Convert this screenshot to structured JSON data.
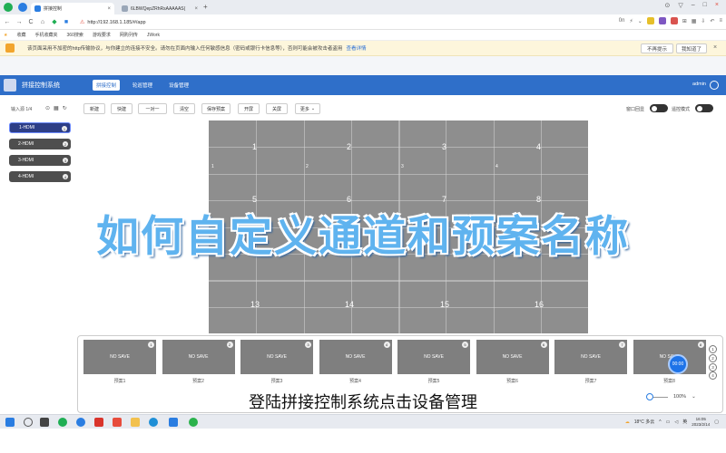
{
  "browser": {
    "tabs": [
      {
        "label": "拼接控制",
        "active": true
      },
      {
        "label": "6LBWQepZRhRsAAAAAS(",
        "active": false
      }
    ],
    "url": "http://192.168.1.185/#/app",
    "bookmarks": [
      "收藏",
      "手机收藏夹",
      "360搜索",
      "游戏要求",
      "网购列传",
      "JWork"
    ]
  },
  "warning": {
    "text": "该页面采用不加密的http传输协议，与你建立的连接不安全。请勿在页面内输入任何敏感信息（密码或银行卡信息等），否则可能会被攻击者盗用",
    "link": "查看详情",
    "dismiss": "不再提示",
    "ok": "我知道了"
  },
  "app": {
    "title": "拼接控制系统",
    "nav": [
      "拼接控制",
      "轮巡管理",
      "设备管理"
    ],
    "user": "admin"
  },
  "sidebar": {
    "inputs_label": "输入源 1/4",
    "channels": [
      {
        "label": "1-HDMI",
        "num": "1"
      },
      {
        "label": "2-HDMI",
        "num": "2"
      },
      {
        "label": "3-HDMI",
        "num": "3"
      },
      {
        "label": "4-HDMI",
        "num": "4"
      }
    ]
  },
  "toolbar": {
    "buttons": [
      "新建",
      "快建",
      "一对一",
      "清空",
      "保存预案",
      "开屏",
      "关屏",
      "更多"
    ],
    "toggle1": "窗口回显",
    "toggle2": "遥控模式"
  },
  "wall": {
    "screens": [
      "1",
      "2",
      "3",
      "4",
      "5",
      "6",
      "7",
      "8",
      "9",
      "10",
      "11",
      "12",
      "13",
      "14",
      "15",
      "16"
    ],
    "sub_labels": [
      "1",
      "2",
      "3",
      "4"
    ],
    "mid_labels": [
      "1",
      "2"
    ]
  },
  "presets": {
    "items": [
      {
        "text": "NO SAVE",
        "num": "1",
        "label": "预案1"
      },
      {
        "text": "NO SAVE",
        "num": "2",
        "label": "预案2"
      },
      {
        "text": "NO SAVE",
        "num": "3",
        "label": "预案3"
      },
      {
        "text": "NO SAVE",
        "num": "4",
        "label": "预案4"
      },
      {
        "text": "NO SAVE",
        "num": "5",
        "label": "预案5"
      },
      {
        "text": "NO SAVE",
        "num": "6",
        "label": "预案6"
      },
      {
        "text": "NO SAVE",
        "num": "7",
        "label": "预案7"
      },
      {
        "text": "NO SAVE",
        "num": "8",
        "label": "预案8"
      }
    ],
    "rail": [
      "1",
      "2",
      "3",
      "4"
    ],
    "fab": "00:00",
    "zoom": "100%"
  },
  "overlay": {
    "title": "如何自定义通道和预案名称",
    "subtitle": "登陆拼接控制系统点击设备管理"
  },
  "taskbar": {
    "weather": "18°C 多云",
    "time": "16:05",
    "date": "2023/2/14",
    "lang": "英"
  }
}
